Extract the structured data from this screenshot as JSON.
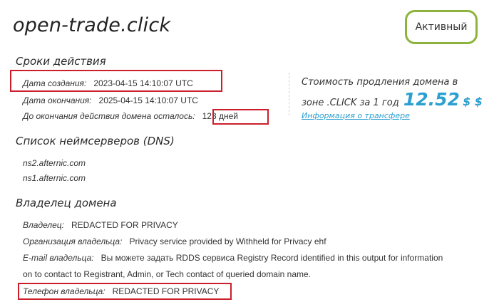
{
  "domain": "open-trade.click",
  "status": "Активный",
  "validity": {
    "heading": "Сроки действия",
    "created_label": "Дата создания:",
    "created_value": "2023-04-15 14:10:07 UTC",
    "expires_label": "Дата окончания:",
    "expires_value": "2025-04-15 14:10:07 UTC",
    "remaining_label": "До окончания действия домена осталось:",
    "remaining_value": "123 дней"
  },
  "renewal": {
    "text_line1": "Стоимость продления домена в",
    "text_line2": "зоне .CLICK за 1 год",
    "price": "12.52",
    "currency": "$ $",
    "transfer_link": "Информация о трансфере"
  },
  "nameservers": {
    "heading": "Список неймсерверов (DNS)",
    "items": [
      "ns2.afternic.com",
      "ns1.afternic.com"
    ]
  },
  "owner": {
    "heading": "Владелец домена",
    "owner_label": "Владелец:",
    "owner_value": "REDACTED FOR PRIVACY",
    "org_label": "Организация владельца:",
    "org_value": "Privacy service provided by Withheld for Privacy ehf",
    "email_label": "E-mail владельца:",
    "email_value": "Вы можете задать RDDS сервиса Registry Record identified in this output for information",
    "email_value_cont": "on to contact to Registrant, Admin, or Tech contact of queried domain name.",
    "phone_label": "Телефон владельца:",
    "phone_value": "REDACTED FOR PRIVACY"
  },
  "colors": {
    "accent": "#2a9fd0",
    "badge_border": "#8cb43c",
    "highlight": "#cc1f2b"
  }
}
